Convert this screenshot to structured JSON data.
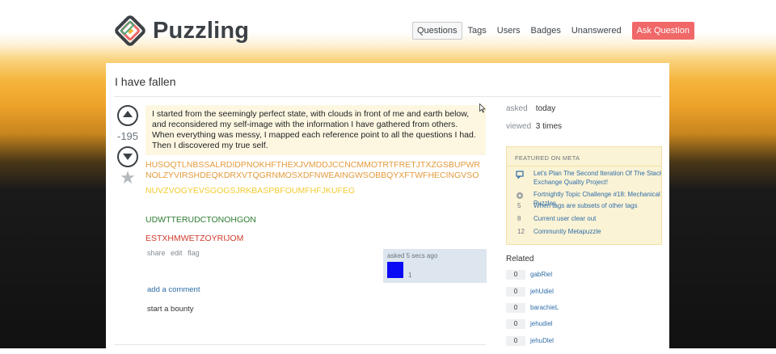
{
  "site": {
    "name": "Puzzling"
  },
  "nav": [
    {
      "label": "Questions",
      "active": true
    },
    {
      "label": "Tags",
      "active": false
    },
    {
      "label": "Users",
      "active": false
    },
    {
      "label": "Badges",
      "active": false
    },
    {
      "label": "Unanswered",
      "active": false
    }
  ],
  "ask_button": "Ask Question",
  "question": {
    "title": "I have fallen",
    "score": "-195",
    "spoiler_text": "I started from the seemingly perfect state, with clouds in front of me and earth below, and reconsidered my self-image with the information I have gathered from others. When everything was messy, I mapped each reference point to all the questions I had. Then I discovered my true self.",
    "line_orange": "HUSOQTLNBSSALRDIDPNOKHFTHEXJVMDDJCCNCMMOTRTFRETJTXZGSBUPWRNOLZYVIRSHDEQKDRXVTQGRNMOSXDFNWEAINGWSOBBQYXFTWFHECINGVSO",
    "line_yellow": "NUVZVOGYEVSGOGSJRKBASPBFOUMFHFJKUFEG",
    "line_green": "UDWTTERUDCTONOHGON",
    "line_red": "ESTXHMWETZOYRIJOM"
  },
  "post_menu": {
    "share": "share",
    "edit": "edit",
    "flag": "flag"
  },
  "signature": {
    "asked": "asked 5 secs ago",
    "reputation": "1"
  },
  "add_comment": "add a comment",
  "start_bounty": "start a bounty",
  "stats": {
    "asked_label": "asked",
    "asked_value": "today",
    "viewed_label": "viewed",
    "viewed_value": "3 times"
  },
  "featured_meta": {
    "heading": "FEATURED ON META",
    "items": [
      {
        "icon": "meta-post-icon",
        "text": "Let's Plan The Second Iteration Of The Stack Exchange Quality Project!"
      },
      {
        "icon": "puzzle-piece-icon",
        "text": "Fortnightly Topic Challenge #18: Mechanical Puzzles"
      },
      {
        "num": "5",
        "text": "When tags are subsets of other tags"
      },
      {
        "num": "8",
        "text": "Current user clear out"
      },
      {
        "num": "12",
        "text": "Community Metapuzzle"
      }
    ]
  },
  "related": {
    "heading": "Related",
    "items": [
      {
        "count": "0",
        "title": "gabRiel"
      },
      {
        "count": "0",
        "title": "jehUdiel"
      },
      {
        "count": "0",
        "title": "barachieL"
      },
      {
        "count": "0",
        "title": "jehudiel"
      },
      {
        "count": "0",
        "title": "jehuDlel"
      }
    ]
  },
  "colors": {
    "accent": "#f06868",
    "link": "#2f6da8",
    "orange_text": "#e49b3c",
    "yellow_text": "#f2cc33",
    "green_text": "#2f7d32",
    "red_text": "#d23c2b",
    "avatar": "#0a0af5"
  }
}
